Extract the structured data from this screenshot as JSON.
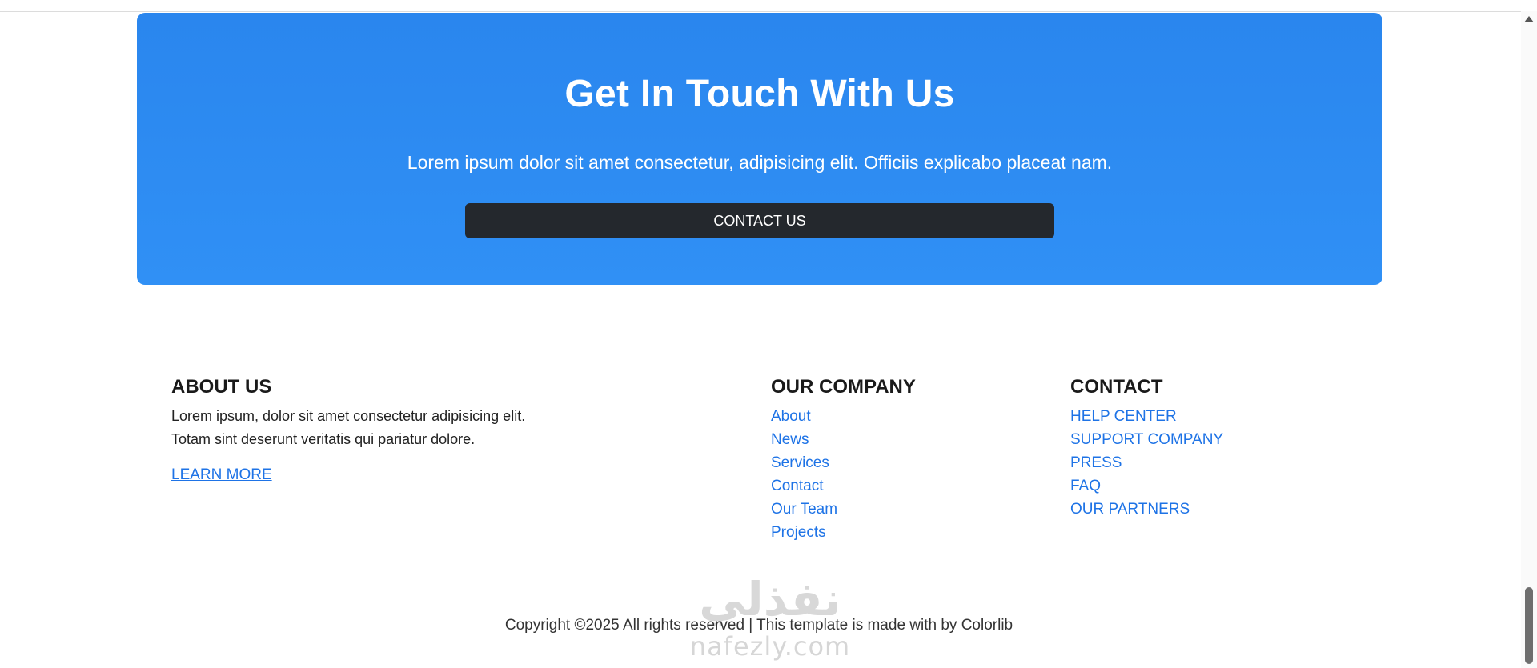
{
  "cta": {
    "title": "Get In Touch With Us",
    "text": "Lorem ipsum dolor sit amet consectetur, adipisicing elit. Officiis explicabo placeat nam.",
    "button": "CONTACT US"
  },
  "about": {
    "heading": "ABOUT US",
    "text": "Lorem ipsum, dolor sit amet consectetur adipisicing elit. Totam sint deserunt veritatis qui pariatur dolore.",
    "link": "LEARN MORE"
  },
  "company": {
    "heading": "OUR COMPANY",
    "links": [
      "About",
      "News",
      "Services",
      "Contact",
      "Our Team",
      "Projects"
    ]
  },
  "contact": {
    "heading": "CONTACT",
    "links": [
      "HELP CENTER",
      "SUPPORT COMPANY",
      "PRESS",
      "FAQ",
      "OUR PARTNERS"
    ]
  },
  "footer": {
    "copyright": "Copyright ©2025 All rights reserved | This template is made with by Colorlib"
  },
  "watermark": {
    "arabic": "نفذلي",
    "latin": "nafezly.com"
  },
  "colors": {
    "cta_bg": "#2a86ee",
    "button_bg": "#24282d",
    "link": "#1e73e6"
  }
}
